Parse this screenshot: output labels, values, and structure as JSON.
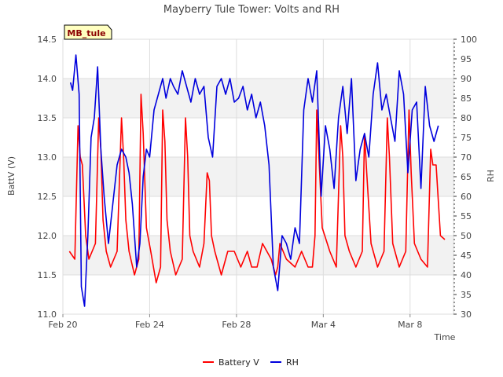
{
  "chart_data": {
    "type": "line",
    "title": "Mayberry Tule Tower: Volts and RH",
    "xlabel": "Time",
    "ylabel_left": "BattV (V)",
    "ylabel_right": "RH",
    "badge": "MB_tule",
    "x_range_days": [
      0,
      18
    ],
    "ylim_left": [
      11.0,
      14.5
    ],
    "ylim_right": [
      30,
      100
    ],
    "x_ticks": [
      {
        "day": 0,
        "label": "Feb 20"
      },
      {
        "day": 4,
        "label": "Feb 24"
      },
      {
        "day": 8,
        "label": "Feb 28"
      },
      {
        "day": 12,
        "label": "Mar 4"
      },
      {
        "day": 16,
        "label": "Mar 8"
      }
    ],
    "y_ticks_left": [
      "11.0",
      "11.5",
      "12.0",
      "12.5",
      "13.0",
      "13.5",
      "14.0",
      "14.5"
    ],
    "y_ticks_right": [
      "30",
      "35",
      "40",
      "45",
      "50",
      "55",
      "60",
      "65",
      "70",
      "75",
      "80",
      "85",
      "90",
      "95",
      "100"
    ],
    "legend": {
      "position": "bottom-center",
      "entries": [
        "Battery V",
        "RH"
      ]
    },
    "colors": {
      "battery": "#ff0000",
      "rh": "#0000dd",
      "band": "#f2f2f2",
      "grid": "#dddddd",
      "badge_bg": "#ffffc0",
      "badge_text": "#8b0000"
    },
    "series": [
      {
        "name": "Battery V",
        "axis": "left",
        "x": [
          0.3,
          0.55,
          0.7,
          0.8,
          0.9,
          1.05,
          1.2,
          1.5,
          1.65,
          1.75,
          1.85,
          2.0,
          2.2,
          2.5,
          2.7,
          2.8,
          2.9,
          3.05,
          3.3,
          3.5,
          3.6,
          3.7,
          3.85,
          4.05,
          4.3,
          4.5,
          4.6,
          4.7,
          4.8,
          4.95,
          5.2,
          5.5,
          5.65,
          5.75,
          5.85,
          6.0,
          6.3,
          6.5,
          6.65,
          6.75,
          6.85,
          7.0,
          7.3,
          7.6,
          7.9,
          8.2,
          8.5,
          8.7,
          8.85,
          8.95,
          9.2,
          9.6,
          9.8,
          9.9,
          10.0,
          10.3,
          10.7,
          11.0,
          11.3,
          11.5,
          11.62,
          11.7,
          11.8,
          11.95,
          12.3,
          12.6,
          12.8,
          12.9,
          13.0,
          13.2,
          13.5,
          13.8,
          13.9,
          14.0,
          14.2,
          14.5,
          14.8,
          14.95,
          15.05,
          15.2,
          15.5,
          15.8,
          15.95,
          16.05,
          16.2,
          16.5,
          16.8,
          16.95,
          17.05,
          17.2,
          17.4,
          17.6
        ],
        "values": [
          11.8,
          11.7,
          13.4,
          13.0,
          12.9,
          12.0,
          11.7,
          11.9,
          13.5,
          13.1,
          12.2,
          11.8,
          11.6,
          11.8,
          13.5,
          13.0,
          12.2,
          11.8,
          11.5,
          11.7,
          13.8,
          13.3,
          12.1,
          11.8,
          11.4,
          11.6,
          13.6,
          13.2,
          12.2,
          11.8,
          11.5,
          11.7,
          13.5,
          13.0,
          12.0,
          11.8,
          11.6,
          11.9,
          12.8,
          12.7,
          12.0,
          11.8,
          11.5,
          11.8,
          11.8,
          11.6,
          11.8,
          11.6,
          11.6,
          11.6,
          11.9,
          11.7,
          11.5,
          11.6,
          11.9,
          11.7,
          11.6,
          11.8,
          11.6,
          11.6,
          12.0,
          13.6,
          13.0,
          12.1,
          11.8,
          11.6,
          13.4,
          13.0,
          12.0,
          11.8,
          11.6,
          11.8,
          13.3,
          12.8,
          11.9,
          11.6,
          11.8,
          13.5,
          13.0,
          11.9,
          11.6,
          11.8,
          13.6,
          12.8,
          11.9,
          11.7,
          11.6,
          13.1,
          12.9,
          12.9,
          12.0,
          11.95
        ]
      },
      {
        "name": "RH",
        "axis": "right",
        "x": [
          0.35,
          0.45,
          0.6,
          0.75,
          0.85,
          1.0,
          1.15,
          1.3,
          1.45,
          1.6,
          1.75,
          1.9,
          2.1,
          2.3,
          2.5,
          2.7,
          2.9,
          3.05,
          3.2,
          3.4,
          3.55,
          3.7,
          3.85,
          4.0,
          4.2,
          4.4,
          4.6,
          4.75,
          4.95,
          5.1,
          5.3,
          5.5,
          5.7,
          5.9,
          6.1,
          6.3,
          6.5,
          6.7,
          6.9,
          7.1,
          7.3,
          7.5,
          7.7,
          7.9,
          8.1,
          8.3,
          8.5,
          8.7,
          8.9,
          9.1,
          9.3,
          9.5,
          9.7,
          9.9,
          10.1,
          10.3,
          10.5,
          10.7,
          10.9,
          11.1,
          11.3,
          11.5,
          11.7,
          11.9,
          12.1,
          12.3,
          12.5,
          12.7,
          12.9,
          13.1,
          13.3,
          13.5,
          13.7,
          13.9,
          14.1,
          14.3,
          14.5,
          14.7,
          14.9,
          15.1,
          15.3,
          15.5,
          15.7,
          15.9,
          16.1,
          16.3,
          16.5,
          16.7,
          16.9,
          17.1,
          17.3
        ],
        "values": [
          89,
          87,
          96,
          86,
          37,
          32,
          50,
          75,
          80,
          93,
          72,
          60,
          48,
          58,
          68,
          72,
          70,
          66,
          58,
          42,
          48,
          65,
          72,
          70,
          82,
          86,
          90,
          85,
          90,
          88,
          86,
          92,
          88,
          84,
          90,
          86,
          88,
          75,
          70,
          88,
          90,
          86,
          90,
          84,
          85,
          88,
          82,
          86,
          80,
          84,
          78,
          68,
          42,
          36,
          50,
          48,
          44,
          52,
          48,
          82,
          90,
          84,
          92,
          60,
          78,
          72,
          62,
          80,
          88,
          76,
          90,
          64,
          72,
          76,
          70,
          86,
          94,
          82,
          86,
          80,
          74,
          92,
          86,
          66,
          82,
          84,
          62,
          88,
          78,
          74,
          78
        ]
      }
    ]
  }
}
